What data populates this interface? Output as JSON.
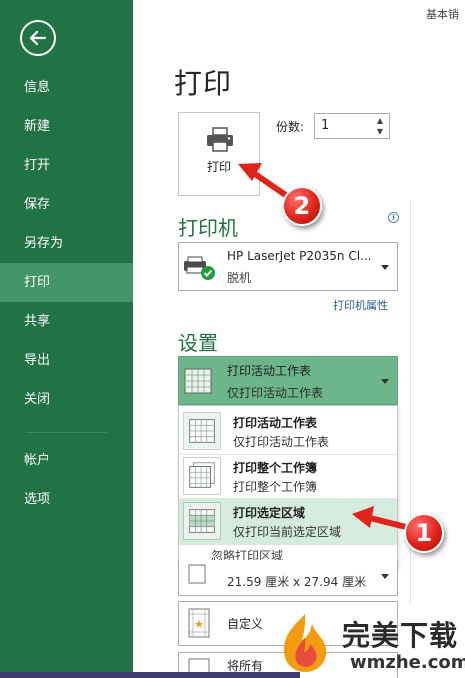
{
  "top_title": "基本销",
  "sidebar": {
    "items": [
      {
        "label": "信息"
      },
      {
        "label": "新建"
      },
      {
        "label": "打开"
      },
      {
        "label": "保存"
      },
      {
        "label": "另存为"
      },
      {
        "label": "打印"
      },
      {
        "label": "共享"
      },
      {
        "label": "导出"
      },
      {
        "label": "关闭"
      }
    ],
    "bottom_items": [
      {
        "label": "帐户"
      },
      {
        "label": "选项"
      }
    ],
    "active": "打印"
  },
  "page_title": "打印",
  "print_button": {
    "label": "打印"
  },
  "copies": {
    "label": "份数:",
    "value": "1"
  },
  "printer": {
    "header": "打印机",
    "name": "HP LaserJet P2035n Cl...",
    "status": "脱机",
    "properties_link": "打印机属性"
  },
  "settings": {
    "header": "设置",
    "selected": {
      "title": "打印活动工作表",
      "desc": "仅打印活动工作表"
    },
    "options": [
      {
        "title": "打印活动工作表",
        "desc": "仅打印活动工作表",
        "selected": false
      },
      {
        "title": "打印整个工作簿",
        "desc": "打印整个工作簿",
        "selected": false
      },
      {
        "title": "打印选定区域",
        "desc": "仅打印当前选定区域",
        "selected": true
      }
    ],
    "ignore_print_area": "忽略打印区域",
    "paper_size": "21.59 厘米 x 27.94 厘米",
    "margins": "自定义",
    "scaling": "将所有"
  },
  "callouts": [
    "1",
    "2"
  ],
  "watermark": {
    "brand": "完美下载",
    "url": "wmzhe.com"
  },
  "colors": {
    "sidebar": "#217346",
    "active_nav": "#439467",
    "accent_green": "#217346",
    "callout_red": "#e2231a"
  }
}
